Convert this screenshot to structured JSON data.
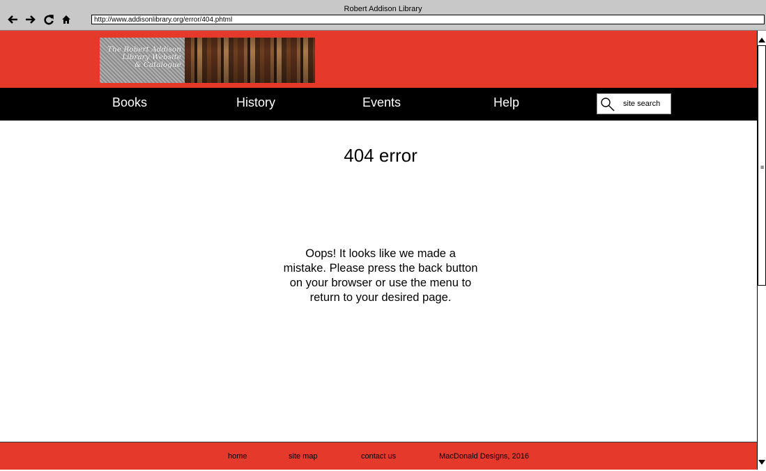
{
  "browser": {
    "window_title": "Robert Addison Library",
    "url": "http://www.addisonlibrary.org/error/404.phtml",
    "buttons": [
      "back-icon",
      "forward-icon",
      "reload-icon",
      "home-icon"
    ]
  },
  "header": {
    "logo_text_line1": "The Robert Addison",
    "logo_text_line2": "Library Website",
    "logo_text_line3": "& Catalogue",
    "background_color": "#e5392c"
  },
  "nav": {
    "items": [
      {
        "label": "Books"
      },
      {
        "label": "History"
      },
      {
        "label": "Events"
      },
      {
        "label": "Help"
      }
    ],
    "search_placeholder": "site search"
  },
  "main": {
    "title": "404 error",
    "message": "Oops! It looks like we made a mistake. Please press the back button on your browser or use the menu to return to your desired page."
  },
  "footer": {
    "links": [
      {
        "label": "home"
      },
      {
        "label": "site map"
      },
      {
        "label": "contact us"
      }
    ],
    "credit": "MacDonald Designs, 2016"
  }
}
